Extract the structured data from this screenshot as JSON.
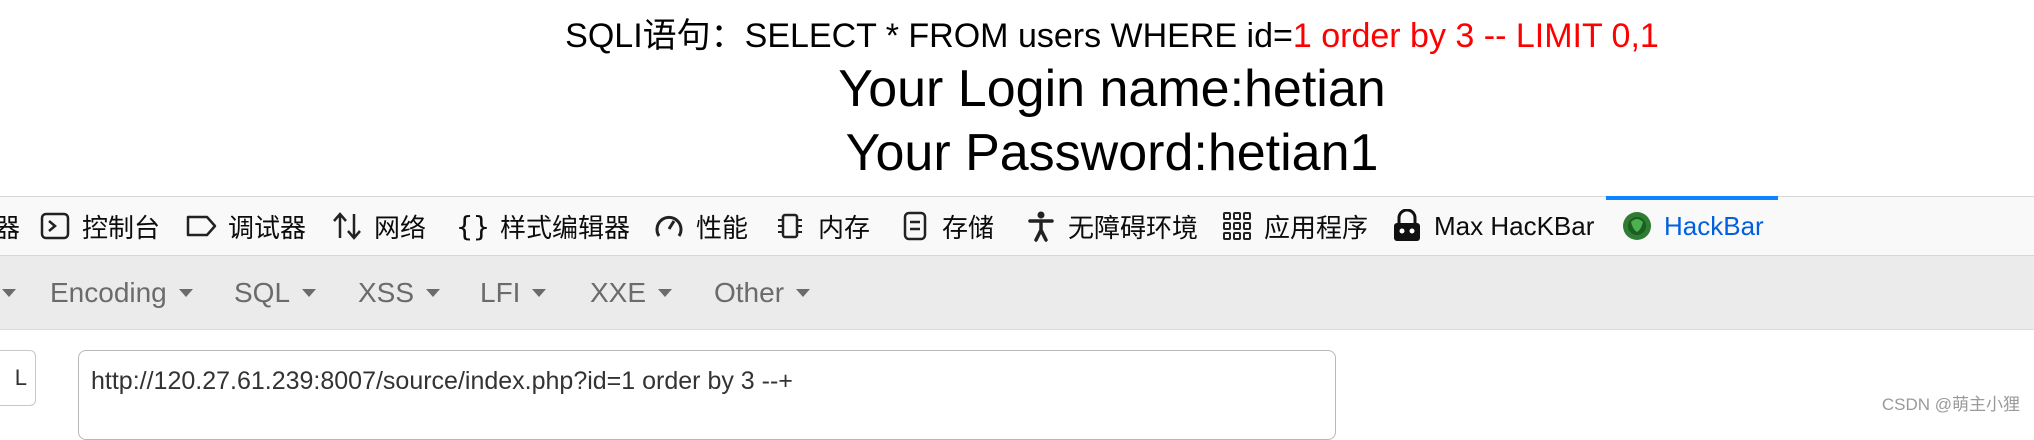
{
  "page": {
    "sqli_prefix": "SQLI语句：SELECT * FROM users WHERE id=",
    "sqli_injected": "1 order by 3 -- LIMIT 0,1",
    "login_name": "Your Login name:hetian",
    "password": "Your Password:hetian1"
  },
  "devtools": {
    "tabs": [
      {
        "label": "器",
        "icon": "partial-icon"
      },
      {
        "label": "控制台",
        "icon": "console-icon"
      },
      {
        "label": "调试器",
        "icon": "debugger-icon"
      },
      {
        "label": "网络",
        "icon": "network-icon"
      },
      {
        "label": "样式编辑器",
        "icon": "style-editor-icon"
      },
      {
        "label": "性能",
        "icon": "performance-icon"
      },
      {
        "label": "内存",
        "icon": "memory-icon"
      },
      {
        "label": "存储",
        "icon": "storage-icon"
      },
      {
        "label": "无障碍环境",
        "icon": "accessibility-icon"
      },
      {
        "label": "应用程序",
        "icon": "application-icon"
      },
      {
        "label": "Max HacKBar",
        "icon": "max-hackbar-icon"
      },
      {
        "label": "HackBar",
        "icon": "hackbar-icon",
        "active": true
      }
    ],
    "active_color": "#0060df"
  },
  "hackbar": {
    "menu": [
      {
        "label": "Encoding"
      },
      {
        "label": "SQL"
      },
      {
        "label": "XSS"
      },
      {
        "label": "LFI"
      },
      {
        "label": "XXE"
      },
      {
        "label": "Other"
      }
    ],
    "load_button_label": "L",
    "url_value": "http://120.27.61.239:8007/source/index.php?id=1 order by 3 --+"
  },
  "watermark": "CSDN @萌主小狸"
}
